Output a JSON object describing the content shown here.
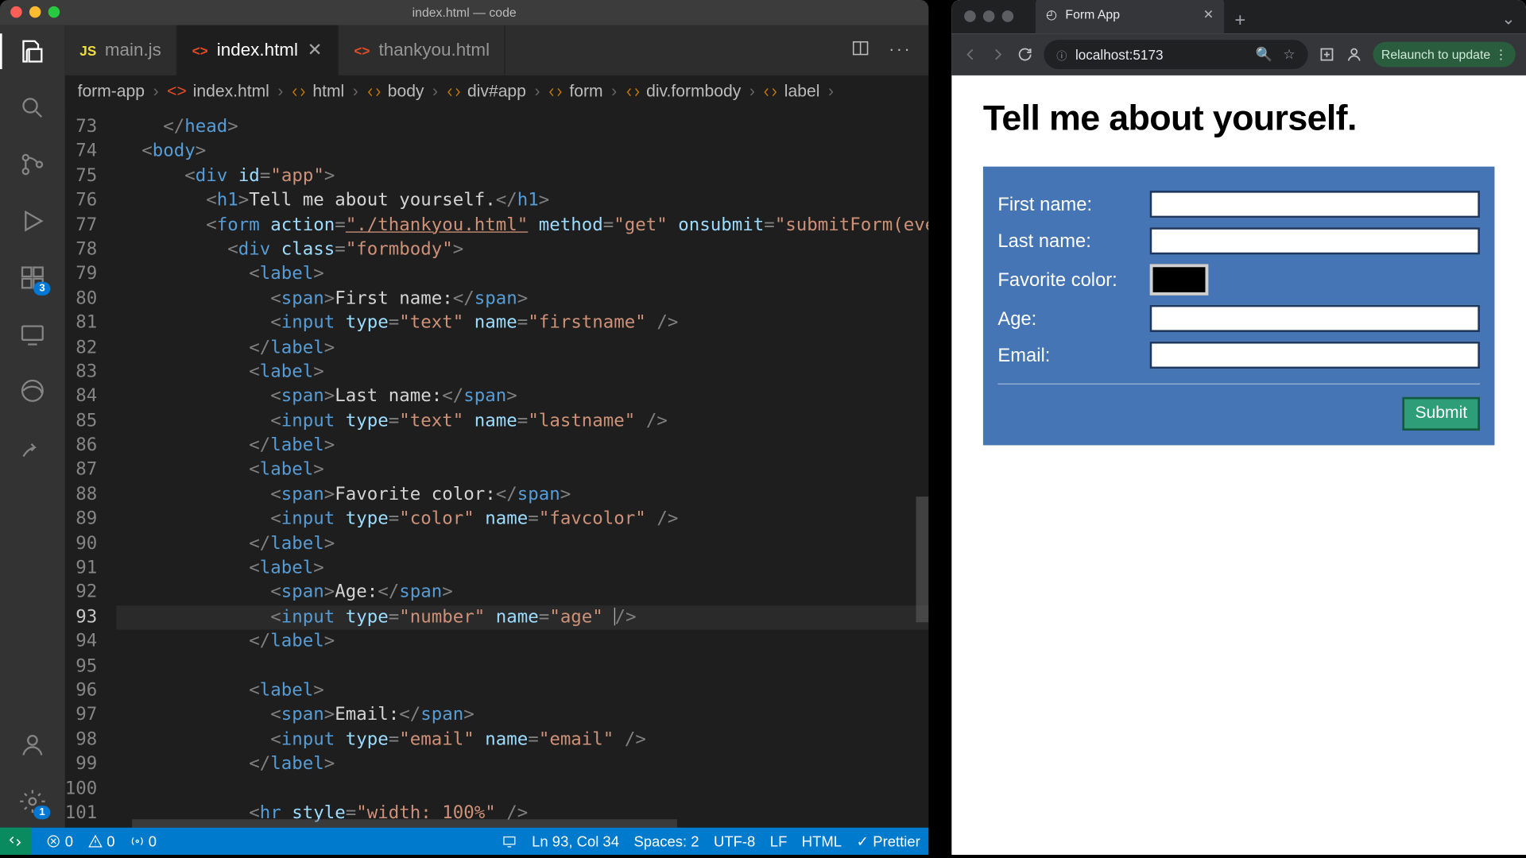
{
  "vscode": {
    "title": "index.html — code",
    "activity_badges": {
      "extensions": "3",
      "settings": "1"
    },
    "tabs": [
      {
        "label": "main.js",
        "icon": "JS",
        "icon_color": "ico-js",
        "active": false,
        "closable": false
      },
      {
        "label": "index.html",
        "icon": "<>",
        "icon_color": "ico-html",
        "active": true,
        "closable": true
      },
      {
        "label": "thankyou.html",
        "icon": "<>",
        "icon_color": "ico-html",
        "active": false,
        "closable": false
      }
    ],
    "breadcrumbs": [
      "form-app",
      "index.html",
      "html",
      "body",
      "div#app",
      "form",
      "div.formbody",
      "label"
    ],
    "gutter_start": 73,
    "cursor_line": 93,
    "statusbar": {
      "errors": "0",
      "warnings": "0",
      "radio": "0",
      "pos": "Ln 93, Col 34",
      "spaces": "Spaces: 2",
      "enc": "UTF-8",
      "eol": "LF",
      "lang": "HTML",
      "prettier": "Prettier"
    }
  },
  "code": {
    "l73": "      </head>",
    "l74": "    <body>",
    "l75_pre": "      ",
    "l75_id": "app",
    "l76_pre": "        ",
    "l76_txt": "Tell me about yourself.",
    "l77_pre": "        ",
    "l77_action": "./thankyou.html",
    "l77_method": "get",
    "l77_onsubmit": "submitForm(event)",
    "l78_pre": "          ",
    "l78_class": "formbody",
    "l79_pre": "            ",
    "l80_pre": "              ",
    "l80_txt": "First name:",
    "l81_pre": "              ",
    "l81_type": "text",
    "l81_name": "firstname",
    "l82_pre": "            ",
    "l83_pre": "            ",
    "l84_pre": "              ",
    "l84_txt": "Last name:",
    "l85_pre": "              ",
    "l85_type": "text",
    "l85_name": "lastname",
    "l86_pre": "            ",
    "l87_pre": "            ",
    "l88_pre": "              ",
    "l88_txt": "Favorite color:",
    "l89_pre": "              ",
    "l89_type": "color",
    "l89_name": "favcolor",
    "l90_pre": "            ",
    "l91_pre": "            ",
    "l92_pre": "              ",
    "l92_txt": "Age:",
    "l93_pre": "              ",
    "l93_type": "number",
    "l93_name": "age",
    "l94_pre": "            ",
    "l95_pre": "",
    "l96_pre": "            ",
    "l97_pre": "              ",
    "l97_txt": "Email:",
    "l98_pre": "              ",
    "l98_type": "email",
    "l98_name": "email",
    "l99_pre": "            ",
    "l100_pre": "",
    "l101_pre": "            ",
    "l101_style": "width: 100%"
  },
  "browser": {
    "tab_title": "Form App",
    "url": "localhost:5173",
    "relaunch": "Relaunch to update",
    "page": {
      "heading": "Tell me about yourself.",
      "fields": {
        "first": "First name:",
        "last": "Last name:",
        "color": "Favorite color:",
        "age": "Age:",
        "email": "Email:"
      },
      "submit": "Submit"
    }
  }
}
